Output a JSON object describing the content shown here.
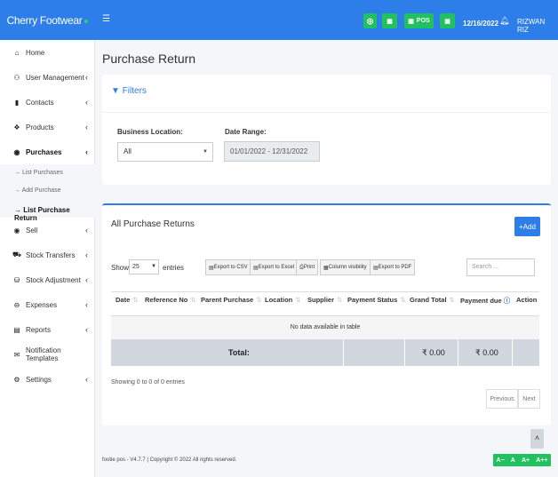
{
  "brand": {
    "name": "Cherry Footwear"
  },
  "topbar": {
    "menu_icon": "hamburger-icon",
    "pos_label": "POS",
    "date": "12/16/2022",
    "user": "RIZWAN RIZ"
  },
  "sidebar": {
    "items": [
      {
        "label": "Home",
        "icon": "home-icon"
      },
      {
        "label": "User Management",
        "icon": "users-icon"
      },
      {
        "label": "Contacts",
        "icon": "address-book-icon"
      },
      {
        "label": "Products",
        "icon": "cubes-icon"
      },
      {
        "label": "Purchases",
        "icon": "arrow-circle-icon"
      },
      {
        "label": "Sell",
        "icon": "arrow-circle-up-icon"
      },
      {
        "label": "Stock Transfers",
        "icon": "truck-icon"
      },
      {
        "label": "Stock Adjustment",
        "icon": "database-icon"
      },
      {
        "label": "Expenses",
        "icon": "minus-circle-icon"
      },
      {
        "label": "Reports",
        "icon": "chart-icon"
      },
      {
        "label": "Notification Templates",
        "icon": "envelope-icon"
      },
      {
        "label": "Settings",
        "icon": "cog-icon"
      }
    ],
    "purchases_sub": [
      {
        "label": "List Purchases"
      },
      {
        "label": "Add Purchase"
      },
      {
        "label": "List Purchase Return"
      }
    ]
  },
  "page": {
    "title": "Purchase Return"
  },
  "filters": {
    "heading": "Filters",
    "business_location_label": "Business Location:",
    "business_location_value": "All",
    "date_range_label": "Date Range:",
    "date_range_value": "01/01/2022 - 12/31/2022"
  },
  "returns": {
    "title": "All Purchase Returns",
    "add_label": "Add",
    "show_label": "Show",
    "entries_value": "25",
    "entries_label": "entries",
    "export_csv": "Export to CSV",
    "export_excel": "Export to Excel",
    "print": "Print",
    "column_visibility": "Column visibility",
    "export_pdf": "Export to PDF",
    "search_placeholder": "Search ...",
    "columns": [
      "Date",
      "Reference No",
      "Parent Purchase",
      "Location",
      "Supplier",
      "Payment Status",
      "Grand Total",
      "Payment due",
      "Action"
    ],
    "no_data": "No data available in table",
    "total_label": "Total:",
    "grand_total": "₹ 0.00",
    "payment_due_total": "₹ 0.00",
    "showing": "Showing 0 to 0 of 0 entries",
    "previous": "Previous",
    "next": "Next"
  },
  "footer": {
    "text": "footie pos - V4.7.7 | Copyright © 2022 All rights reserved.",
    "font_controls": [
      "A−",
      "A",
      "A+",
      "A++"
    ]
  }
}
